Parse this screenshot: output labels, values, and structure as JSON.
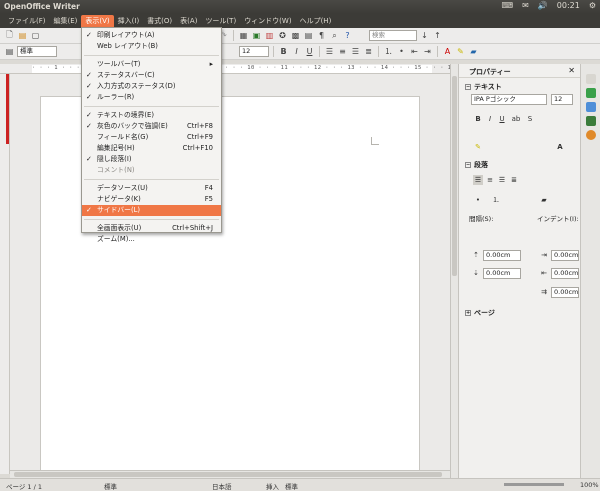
{
  "window": {
    "title": "OpenOffice Writer",
    "clock": "00:21",
    "tray_icons": [
      "keyboard-icon",
      "mail-icon",
      "volume-icon",
      "settings-icon"
    ]
  },
  "menubar": {
    "items": [
      "ファイル(F)",
      "編集(E)",
      "表示(V)",
      "挿入(I)",
      "書式(O)",
      "表(A)",
      "ツール(T)",
      "ウィンドウ(W)",
      "ヘルプ(H)"
    ],
    "active_index": 2
  },
  "toolbar2": {
    "style_value": "標準",
    "font_size_value": "12",
    "search_placeholder": "検索"
  },
  "ruler": {
    "scale": "· · · 1 · · · ·     · 5 · · · 6 · · · 7 · · · 8 · · · 9 · · · 10 · · · 11 · · · 12 · · · 13 · · · 14 · · · 15 · · · 16 · · · 17 · · · 18"
  },
  "view_menu": {
    "items": [
      {
        "check": "✓",
        "label": "印刷レイアウト(A)",
        "shortcut": "",
        "dim": false
      },
      {
        "check": "",
        "label": "Web レイアウト(B)",
        "shortcut": "",
        "dim": false
      },
      {
        "check": "",
        "label": "ツールバー(T)",
        "shortcut": "▸",
        "dim": false
      },
      {
        "check": "✓",
        "label": "ステータスバー(C)",
        "shortcut": "",
        "dim": false
      },
      {
        "check": "✓",
        "label": "入力方式のステータス(D)",
        "shortcut": "",
        "dim": false
      },
      {
        "check": "✓",
        "label": "ルーラー(R)",
        "shortcut": "",
        "dim": false
      },
      {
        "check": "✓",
        "label": "テキストの境界(E)",
        "shortcut": "",
        "dim": false
      },
      {
        "check": "✓",
        "label": "灰色のバックで強調(E)",
        "shortcut": "Ctrl+F8",
        "dim": false
      },
      {
        "check": "",
        "label": "フィールド名(G)",
        "shortcut": "Ctrl+F9",
        "dim": false
      },
      {
        "check": "",
        "label": "編集記号(H)",
        "shortcut": "Ctrl+F10",
        "dim": false
      },
      {
        "check": "✓",
        "label": "隠し段落(I)",
        "shortcut": "",
        "dim": false
      },
      {
        "check": "",
        "label": "コメント(N)",
        "shortcut": "",
        "dim": true
      },
      {
        "check": "",
        "label": "データソース(U)",
        "shortcut": "F4",
        "dim": false
      },
      {
        "check": "",
        "label": "ナビゲータ(K)",
        "shortcut": "F5",
        "dim": false
      },
      {
        "check": "✓",
        "label": "サイドバー(L)",
        "shortcut": "",
        "dim": false,
        "highlighted": true
      },
      {
        "check": "",
        "label": "全画面表示(U)",
        "shortcut": "Ctrl+Shift+J",
        "dim": false
      },
      {
        "check": "",
        "label": "ズーム(M)...",
        "shortcut": "",
        "dim": false
      }
    ]
  },
  "sidebar": {
    "title": "プロパティー",
    "text_section": {
      "title": "テキスト",
      "font_value": "IPA Pゴシック",
      "size_value": "12"
    },
    "paragraph_section": {
      "title": "段落",
      "spacing_label": "間隔(S):",
      "indent_label": "インデント(I):",
      "spacing_above": "0.00cm",
      "spacing_below": "0.00cm",
      "indent_before": "0.00cm",
      "indent_after": "0.00cm",
      "indent_first": "0.00cm"
    },
    "page_section": {
      "title": "ページ"
    }
  },
  "statusbar": {
    "page": "ページ 1 / 1",
    "style": "標準",
    "language": "日本語",
    "insert_mode": "挿入",
    "selection_mode": "標準",
    "zoom": "100%"
  }
}
